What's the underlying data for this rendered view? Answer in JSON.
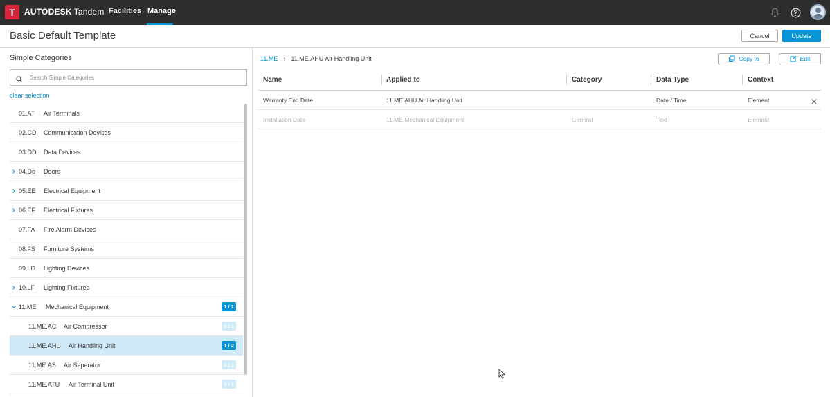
{
  "app": {
    "logo_letter": "T",
    "brand_name": "AUTODESK",
    "product_name": "Tandem",
    "nav": [
      {
        "label": "Facilities"
      },
      {
        "label": "Manage"
      }
    ],
    "icons": [
      "bell-icon",
      "help-icon",
      "avatar"
    ]
  },
  "header": {
    "title": "Basic Default Template",
    "cancel_label": "Cancel",
    "update_label": "Update"
  },
  "left": {
    "title": "Simple Categories",
    "search_placeholder": "Search Simple Categories",
    "clear_label": "clear selection",
    "categories": [
      {
        "code": "01.AT",
        "label": "Air Terminals",
        "expandable": false,
        "expanded": false,
        "indent": 0,
        "badge": ""
      },
      {
        "code": "02.CD",
        "label": "Communication Devices",
        "expandable": false,
        "expanded": false,
        "indent": 0,
        "badge": ""
      },
      {
        "code": "03.DD",
        "label": "Data Devices",
        "expandable": false,
        "expanded": false,
        "indent": 0,
        "badge": ""
      },
      {
        "code": "04.Do",
        "label": "Doors",
        "expandable": true,
        "expanded": false,
        "indent": 0,
        "badge": ""
      },
      {
        "code": "05.EE",
        "label": "Electrical Equipment",
        "expandable": true,
        "expanded": false,
        "indent": 0,
        "badge": ""
      },
      {
        "code": "06.EF",
        "label": "Electrical Fixtures",
        "expandable": true,
        "expanded": false,
        "indent": 0,
        "badge": ""
      },
      {
        "code": "07.FA",
        "label": "Fire Alarm Devices",
        "expandable": false,
        "expanded": false,
        "indent": 0,
        "badge": ""
      },
      {
        "code": "08.FS",
        "label": "Furniture Systems",
        "expandable": false,
        "expanded": false,
        "indent": 0,
        "badge": ""
      },
      {
        "code": "09.LD",
        "label": "Lighting Devices",
        "expandable": false,
        "expanded": false,
        "indent": 0,
        "badge": ""
      },
      {
        "code": "10.LF",
        "label": "Lighting Fixtures",
        "expandable": true,
        "expanded": false,
        "indent": 0,
        "badge": ""
      },
      {
        "code": "11.ME",
        "label": "Mechanical Equipment",
        "expandable": true,
        "expanded": true,
        "indent": 0,
        "badge": "1 / 1",
        "badge_active": true
      },
      {
        "code": "11.ME.AC",
        "label": "Air Compressor",
        "expandable": false,
        "expanded": false,
        "indent": 1,
        "badge": "0 / 1",
        "badge_active": false
      },
      {
        "code": "11.ME.AHU",
        "label": "Air Handling Unit",
        "expandable": false,
        "expanded": false,
        "indent": 1,
        "badge": "1 / 2",
        "badge_active": true,
        "selected": true
      },
      {
        "code": "11.ME.AS",
        "label": "Air Separator",
        "expandable": false,
        "expanded": false,
        "indent": 1,
        "badge": "0 / 1",
        "badge_active": false
      },
      {
        "code": "11.ME.ATU",
        "label": "Air Terminal Unit",
        "expandable": false,
        "expanded": false,
        "indent": 1,
        "badge": "0 / 1",
        "badge_active": false
      }
    ]
  },
  "right": {
    "breadcrumb": {
      "parent": "11.ME",
      "current": "11.ME.AHU Air Handling Unit"
    },
    "copy_label": "Copy to",
    "edit_label": "Edit",
    "columns": [
      "Name",
      "Applied to",
      "Category",
      "Data Type",
      "Context"
    ],
    "rows": [
      {
        "name": "Warranty End Date",
        "applied_to": "11.ME.AHU Air Handling Unit",
        "category": "",
        "data_type": "Date / Time",
        "context": "Element",
        "inactive": false,
        "removable": true
      },
      {
        "name": "Installation Date",
        "applied_to": "11.ME Mechanical Equipment",
        "category": "General",
        "data_type": "Text",
        "context": "Element",
        "inactive": true,
        "removable": false
      }
    ]
  },
  "colors": {
    "accent": "#0696d7",
    "topbar": "#2e2e2e",
    "logo": "#d7253a",
    "selected_row": "#cfe9f6"
  }
}
